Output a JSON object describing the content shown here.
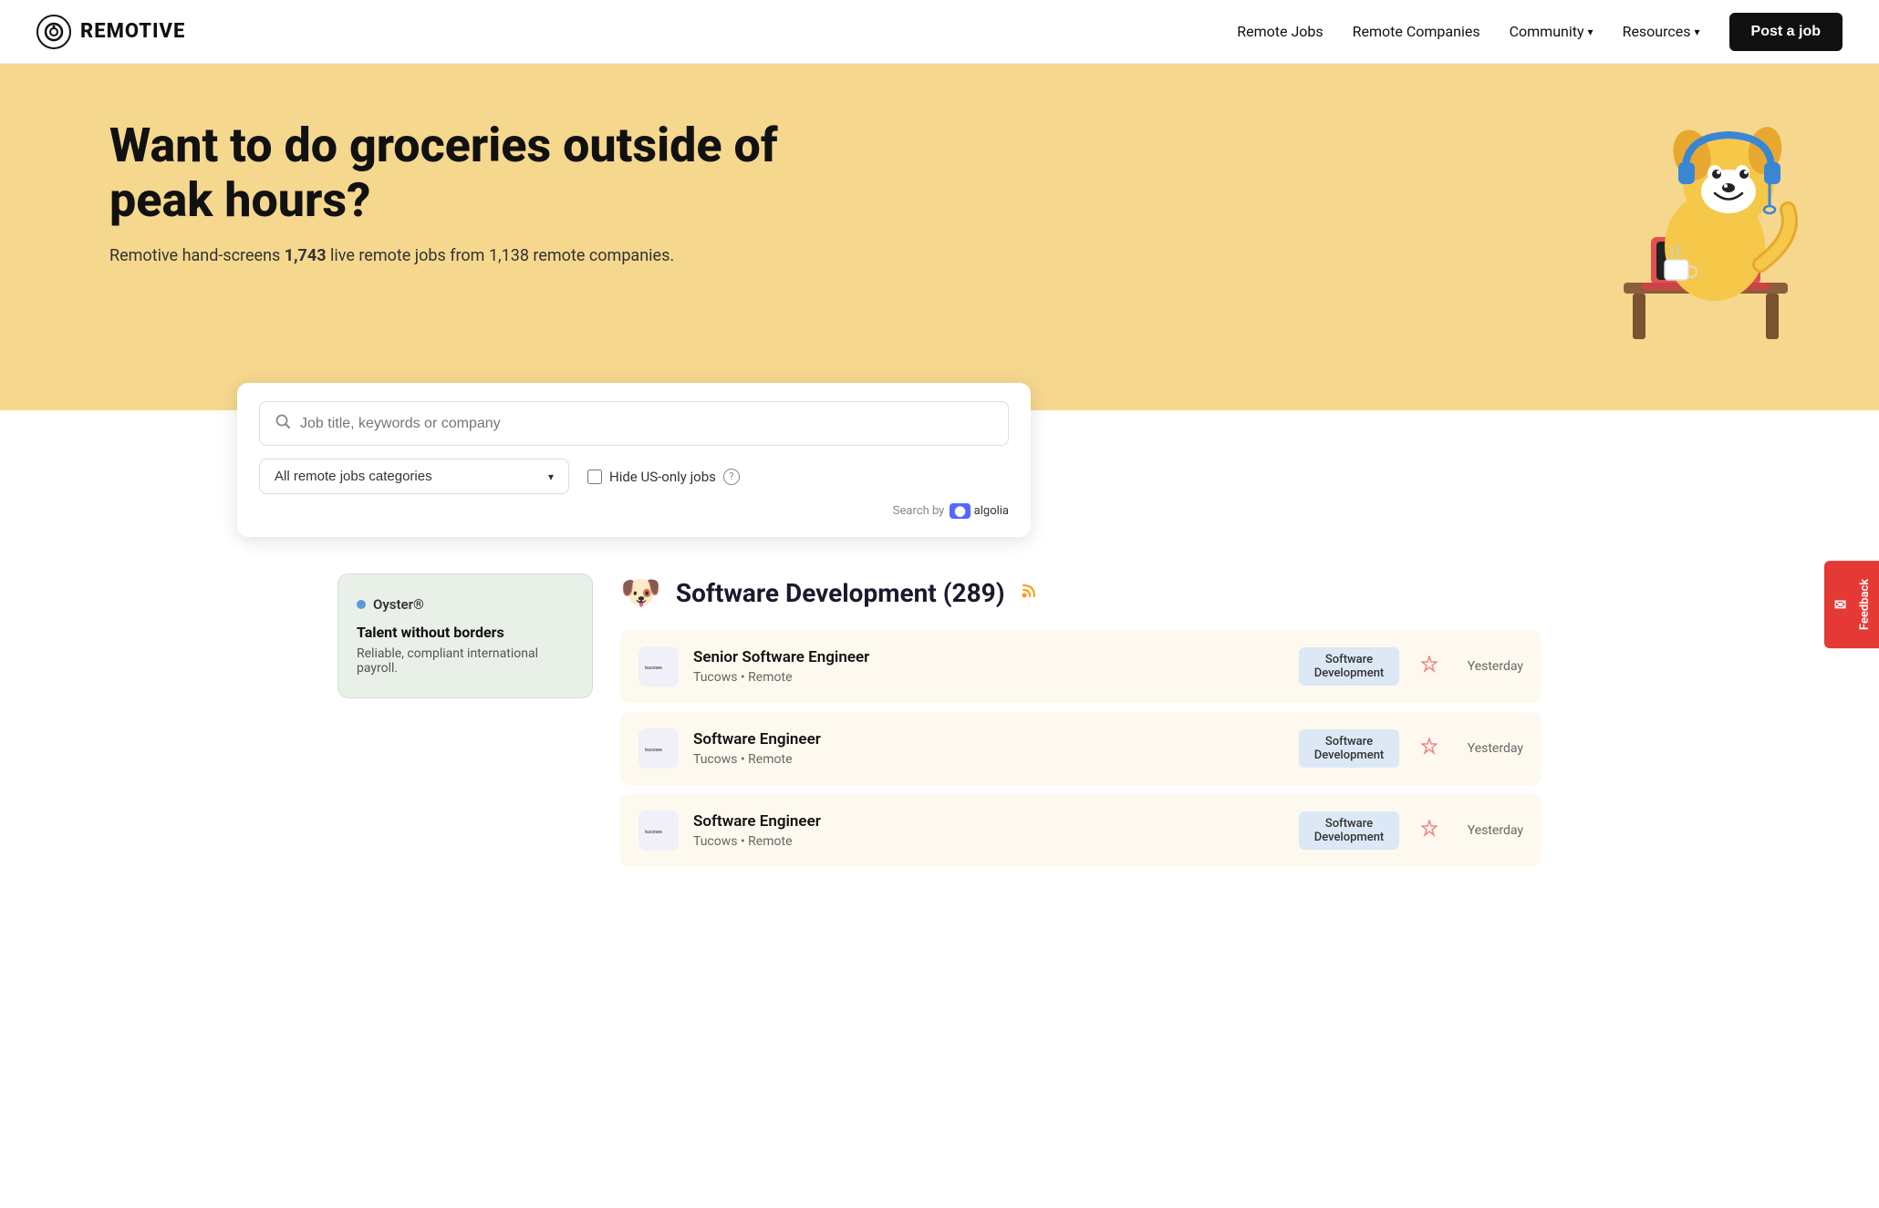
{
  "nav": {
    "logo_icon": "◎",
    "logo_text": "REMOTIVE",
    "links": [
      {
        "id": "remote-jobs",
        "label": "Remote Jobs",
        "dropdown": false
      },
      {
        "id": "remote-companies",
        "label": "Remote Companies",
        "dropdown": false
      },
      {
        "id": "community",
        "label": "Community",
        "dropdown": true
      },
      {
        "id": "resources",
        "label": "Resources",
        "dropdown": true
      }
    ],
    "post_job_label": "Post a job"
  },
  "hero": {
    "title": "Want to do groceries outside of peak hours?",
    "subtitle_prefix": "Remotive hand-screens ",
    "jobs_count": "1,743",
    "subtitle_mid": " live remote jobs from ",
    "companies_count": "1,138",
    "subtitle_suffix": " remote companies."
  },
  "search": {
    "input_placeholder": "Job title, keywords or company",
    "category_default": "All remote jobs categories",
    "hide_us_label": "Hide US-only jobs",
    "search_by_label": "Search by",
    "algolia_label": "algolia"
  },
  "sidebar": {
    "ad": {
      "company": "Oyster®",
      "tagline": "Talent without borders",
      "description": "Reliable, compliant international payroll."
    }
  },
  "jobs_section": {
    "category_emoji": "🐶",
    "category_title": "Software Development",
    "count": 289,
    "rss_label": "RSS",
    "jobs": [
      {
        "id": 1,
        "title": "Senior Software Engineer",
        "company": "Tucows",
        "location": "Remote",
        "tag": "Software\nDevelopment",
        "date": "Yesterday"
      },
      {
        "id": 2,
        "title": "Software Engineer",
        "company": "Tucows",
        "location": "Remote",
        "tag": "Software\nDevelopment",
        "date": "Yesterday"
      },
      {
        "id": 3,
        "title": "Software Engineer",
        "company": "Tucows",
        "location": "Remote",
        "tag": "Software\nDevelopment",
        "date": "Yesterday"
      }
    ]
  },
  "feedback": {
    "label": "Feedback"
  }
}
